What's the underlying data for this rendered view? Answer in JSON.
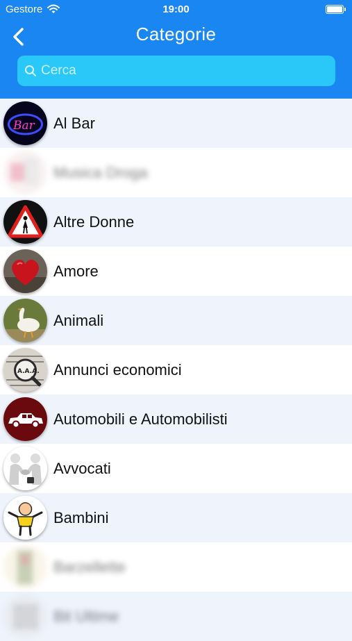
{
  "status_bar": {
    "carrier": "Gestore",
    "time": "19:00"
  },
  "header": {
    "title": "Categorie"
  },
  "search": {
    "placeholder": "Cerca"
  },
  "categories": [
    {
      "label": "Al Bar",
      "icon": "neon-bar-sign-icon"
    },
    {
      "label": "Musica Droga",
      "icon": "blurred-icon"
    },
    {
      "label": "Altre Donne",
      "icon": "warning-sign-woman-icon"
    },
    {
      "label": "Amore",
      "icon": "heart-icon"
    },
    {
      "label": "Animali",
      "icon": "goose-icon"
    },
    {
      "label": "Annunci economici",
      "icon": "magnifier-aaa-icon"
    },
    {
      "label": "Automobili e Automobilisti",
      "icon": "car-icon"
    },
    {
      "label": "Avvocati",
      "icon": "handshake-icon"
    },
    {
      "label": "Bambini",
      "icon": "child-icon"
    },
    {
      "label": "Barzellette",
      "icon": "blurred-icon"
    },
    {
      "label": "Bit Ultime",
      "icon": "blurred-icon"
    }
  ],
  "colors": {
    "header": "#1a86f2",
    "search_bg": "#29c8f9",
    "row_alt": "#eef3fc"
  }
}
